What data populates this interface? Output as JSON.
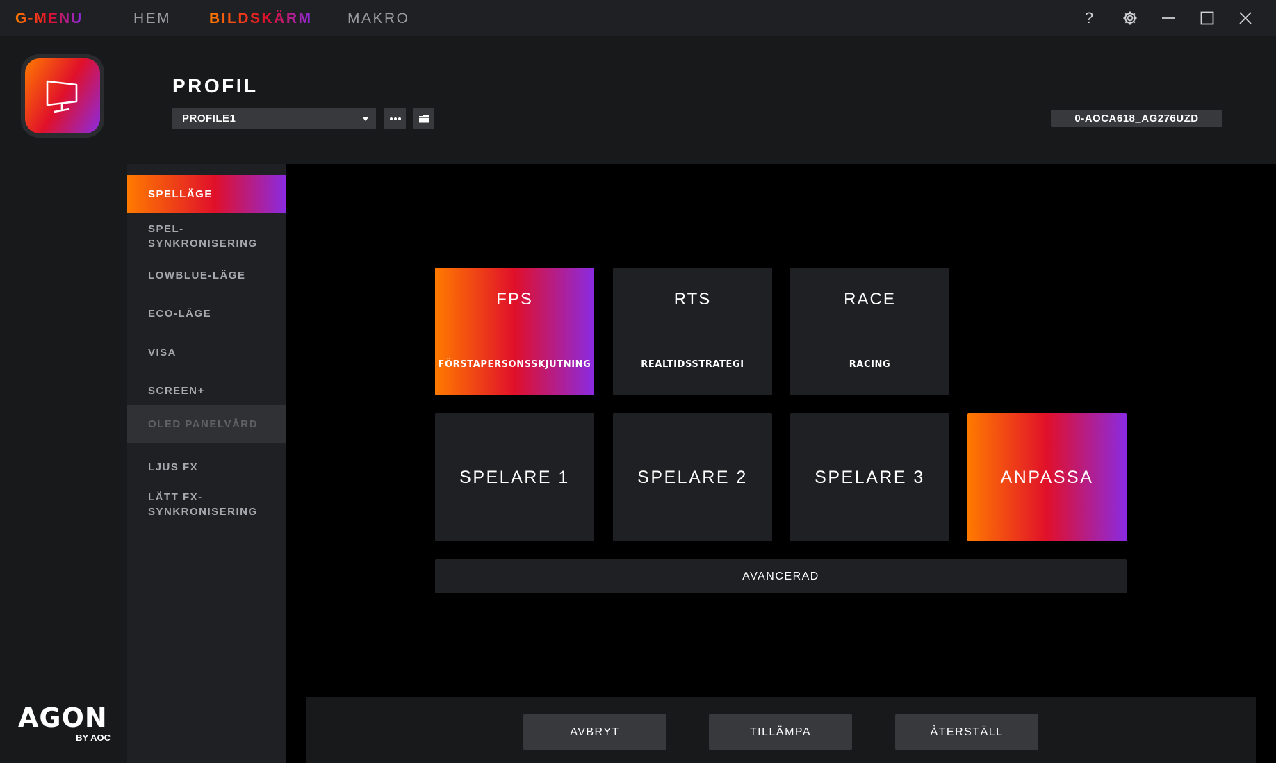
{
  "app": {
    "brand": "G-MENU",
    "accent_gradient": [
      "#ff7a00",
      "#e0102a",
      "#8a2be2"
    ]
  },
  "topnav": {
    "items": [
      {
        "label": "HEM",
        "active": false
      },
      {
        "label": "BILDSKÄRM",
        "active": true
      },
      {
        "label": "MAKRO",
        "active": false
      }
    ]
  },
  "window_controls": {
    "help": "?",
    "icons": [
      "help-icon",
      "gear-icon",
      "minimize-icon",
      "maximize-icon",
      "close-icon"
    ]
  },
  "rail": {
    "monitor_icon": "monitor-icon",
    "logo_main": "AGON",
    "logo_sub": "BY AOC"
  },
  "header": {
    "title": "PROFIL",
    "profile_selected": "PROFILE1",
    "more_icon": "ellipsis-icon",
    "folder_icon": "folder-icon",
    "device_id": "0-AOCA618_AG276UZD"
  },
  "sidemenu": {
    "items": [
      {
        "label": "SPELLÄGE",
        "state": "active"
      },
      {
        "label": "SPEL-\nSYNKRONISERING",
        "state": "normal"
      },
      {
        "label": "LOWBLUE-LÄGE",
        "state": "normal"
      },
      {
        "label": "ECO-LÄGE",
        "state": "normal"
      },
      {
        "label": "VISA",
        "state": "normal"
      },
      {
        "label": "SCREEN+",
        "state": "normal"
      },
      {
        "label": "OLED PANELVÅRD",
        "state": "disabled"
      },
      {
        "label": "LJUS FX",
        "state": "normal"
      },
      {
        "label": "LÄTT FX-\nSYNKRONISERING",
        "state": "normal"
      }
    ]
  },
  "modes": {
    "row1": [
      {
        "title": "FPS",
        "subtitle": "FÖRSTAPERSONSSKJUTNING",
        "selected": true
      },
      {
        "title": "RTS",
        "subtitle": "REALTIDSSTRATEGI",
        "selected": false
      },
      {
        "title": "RACE",
        "subtitle": "RACING",
        "selected": false
      }
    ],
    "row2": [
      {
        "title": "SPELARE 1",
        "selected": false
      },
      {
        "title": "SPELARE 2",
        "selected": false
      },
      {
        "title": "SPELARE 3",
        "selected": false
      },
      {
        "title": "ANPASSA",
        "selected": true
      }
    ],
    "advanced_label": "AVANCERAD"
  },
  "footer": {
    "cancel": "AVBRYT",
    "apply": "TILLÄMPA",
    "reset": "ÅTERSTÄLL"
  }
}
